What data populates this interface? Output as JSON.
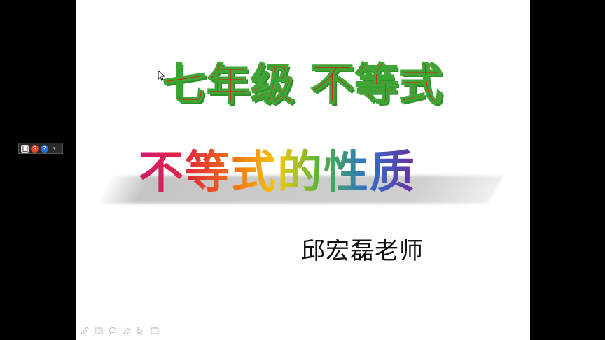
{
  "slide": {
    "title": "七年级  不等式",
    "subtitle": "不等式的性质",
    "teacher": "邱宏磊老师"
  },
  "colors": {
    "title_fill": "#e8141b",
    "title_outline": "#3fa535",
    "background_frame": "#000000",
    "slide_background": "#ffffff"
  },
  "floating_toolbar": {
    "icons": [
      "document-icon",
      "sogou-s-icon",
      "help-icon",
      "dropdown-icon"
    ]
  },
  "bottom_tools": {
    "icons": [
      "pen-icon",
      "slides-icon",
      "lasso-icon",
      "eraser-icon",
      "pointer-icon",
      "screen-icon"
    ]
  }
}
